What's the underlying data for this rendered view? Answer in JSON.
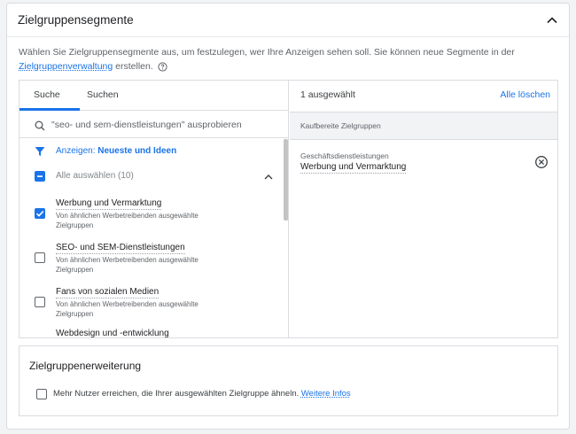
{
  "header": {
    "title": "Zielgruppensegmente"
  },
  "description": {
    "text": "Wählen Sie Zielgruppensegmente aus, um festzulegen, wer Ihre Anzeigen sehen soll. Sie können neue Segmente in der",
    "link": "Zielgruppenverwaltung",
    "suffix": "erstellen."
  },
  "tabs": [
    {
      "label": "Suche",
      "active": true
    },
    {
      "label": "Suchen",
      "active": false
    }
  ],
  "search": {
    "placeholder": "\"seo- und sem-dienstleistungen\" ausprobieren"
  },
  "filter": {
    "prefix": "Anzeigen:",
    "value": "Neueste und Ideen"
  },
  "select_all": {
    "label": "Alle auswählen (10)",
    "state": "indeterminate"
  },
  "items": [
    {
      "title": "Werbung und Vermarktung",
      "subtitle": "Von ähnlichen Werbetreibenden ausgewählte Zielgruppen",
      "checked": true
    },
    {
      "title": "SEO- und SEM-Dienstleistungen",
      "subtitle": "Von ähnlichen Werbetreibenden ausgewählte Zielgruppen",
      "checked": false
    },
    {
      "title": "Fans von sozialen Medien",
      "subtitle": "Von ähnlichen Werbetreibenden ausgewählte Zielgruppen",
      "checked": false
    },
    {
      "title": "Webdesign und -entwicklung",
      "subtitle": "",
      "checked": false
    }
  ],
  "selection": {
    "count_label": "1 ausgewählt",
    "clear_label": "Alle löschen",
    "group_label": "Kaufbereite Zielgruppen",
    "selected": [
      {
        "category": "Geschäftsdienstleistungen",
        "name": "Werbung und Vermarktung"
      }
    ]
  },
  "expansion": {
    "title": "Zielgruppenerweiterung",
    "checkbox_label": "Mehr Nutzer erreichen, die Ihrer ausgewählten Zielgruppe ähneln.",
    "link": "Weitere Infos",
    "checked": false
  },
  "colors": {
    "accent": "#1a73e8",
    "border": "#dadce0",
    "background": "#f1f3f4"
  }
}
